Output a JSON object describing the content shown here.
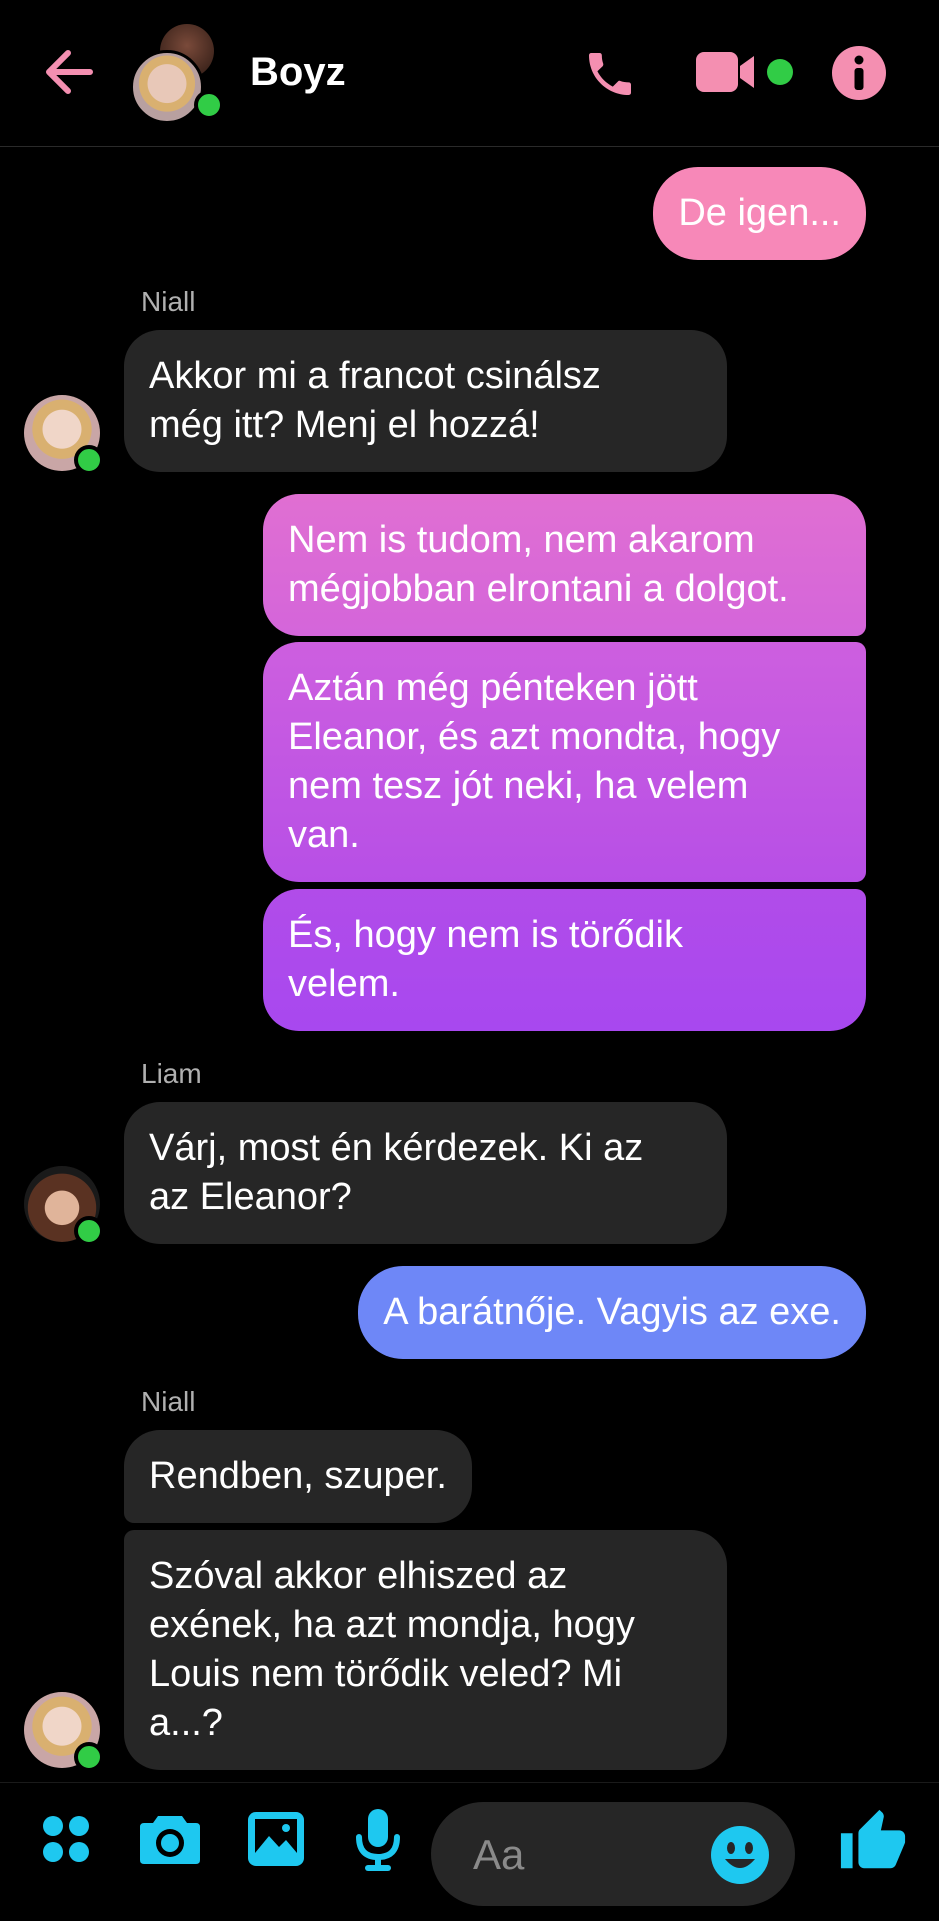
{
  "header": {
    "title": "Boyz",
    "accent": "#f48fb1",
    "icons": [
      "back-arrow-icon",
      "phone-icon",
      "video-camera-icon",
      "info-icon"
    ]
  },
  "messages": [
    {
      "type": "out",
      "text": "De igen..."
    },
    {
      "type": "sender",
      "text": "Niall"
    },
    {
      "type": "in",
      "text": "Akkor mi a francot csinálsz\nmég itt? Menj el hozzá!"
    },
    {
      "type": "out",
      "text": "Nem is tudom, nem akarom\nmégjobban elrontani a dolgot."
    },
    {
      "type": "out",
      "text": "Aztán még pénteken jött\nEleanor, és azt mondta, hogy\nnem tesz jót neki, ha velem\nvan."
    },
    {
      "type": "out",
      "text": "És, hogy nem is törődik\nvelem."
    },
    {
      "type": "sender",
      "text": "Liam"
    },
    {
      "type": "in",
      "text": "Várj, most én kérdezek. Ki az\naz Eleanor?"
    },
    {
      "type": "out",
      "text": "A barátnője. Vagyis az exe."
    },
    {
      "type": "sender",
      "text": "Niall"
    },
    {
      "type": "in",
      "text": "Rendben, szuper."
    },
    {
      "type": "in",
      "text": "Szóval akkor elhiszed az\nexének, ha azt mondja, hogy\nLouis nem törődik veled? Mi\na...?"
    }
  ],
  "composer": {
    "placeholder": "Aa",
    "accent": "#1ec8f0",
    "icons": [
      "apps-icon",
      "camera-icon",
      "gallery-icon",
      "microphone-icon",
      "emoji-icon",
      "thumbs-up-icon"
    ]
  },
  "colors": {
    "out_gradient_top": "#f57fc0",
    "out_gradient_mid": "#c356e0",
    "out_gradient_bottom": "#6d87f7",
    "incoming": "#262626",
    "online": "#31cc46"
  }
}
